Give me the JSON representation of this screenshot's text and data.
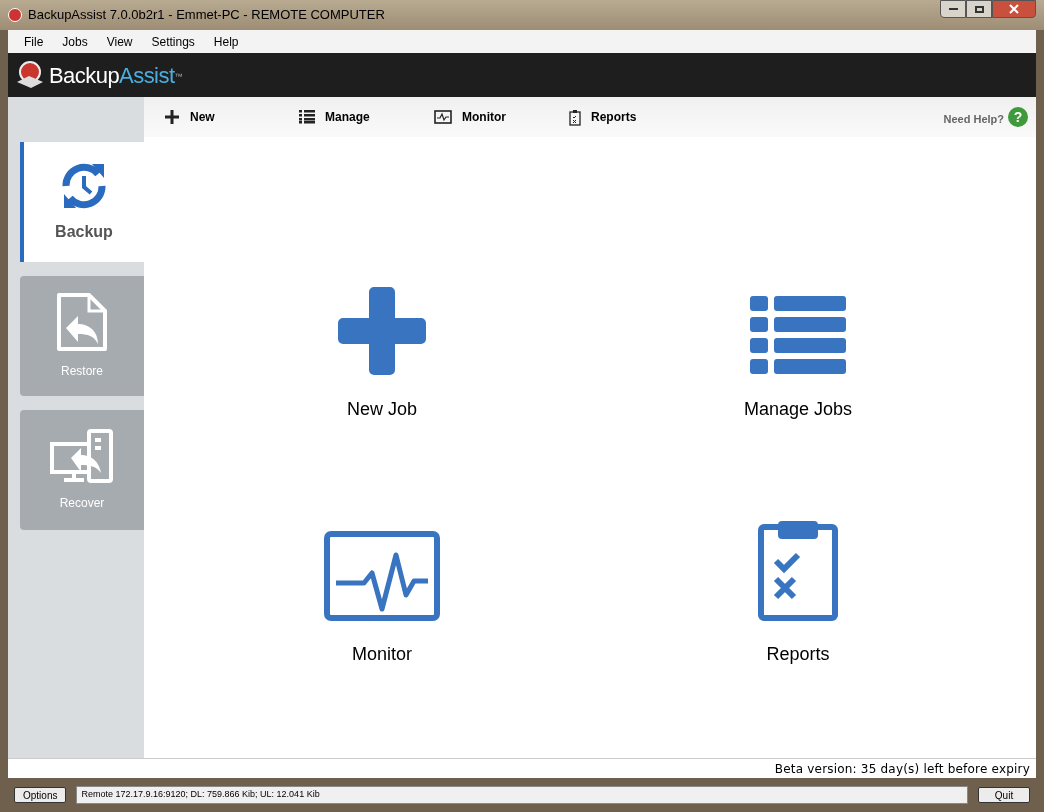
{
  "window": {
    "title": "BackupAssist 7.0.0b2r1 - Emmet-PC - REMOTE COMPUTER"
  },
  "menu": [
    "File",
    "Jobs",
    "View",
    "Settings",
    "Help"
  ],
  "logo": {
    "part1": "Backup",
    "part2": "Assist",
    "trademark": "™"
  },
  "toolbar": [
    {
      "kind": "new",
      "label": "New"
    },
    {
      "kind": "manage",
      "label": "Manage"
    },
    {
      "kind": "monitor",
      "label": "Monitor"
    },
    {
      "kind": "reports",
      "label": "Reports"
    }
  ],
  "help": {
    "label": "Need Help?",
    "glyph": "?"
  },
  "sidebar": [
    {
      "kind": "backup",
      "label": "Backup",
      "selected": true
    },
    {
      "kind": "restore",
      "label": "Restore",
      "selected": false
    },
    {
      "kind": "recover",
      "label": "Recover",
      "selected": false
    }
  ],
  "tiles": [
    {
      "kind": "new",
      "label": "New Job"
    },
    {
      "kind": "manage",
      "label": "Manage Jobs"
    },
    {
      "kind": "monitor",
      "label": "Monitor"
    },
    {
      "kind": "reports",
      "label": "Reports"
    }
  ],
  "notice": "Beta version: 35 day(s) left before expiry",
  "status_bar": {
    "options": "Options",
    "status": "Remote 172.17.9.16:9120; DL: 759.866 Kib; UL: 12.041 Kib",
    "quit": "Quit"
  }
}
